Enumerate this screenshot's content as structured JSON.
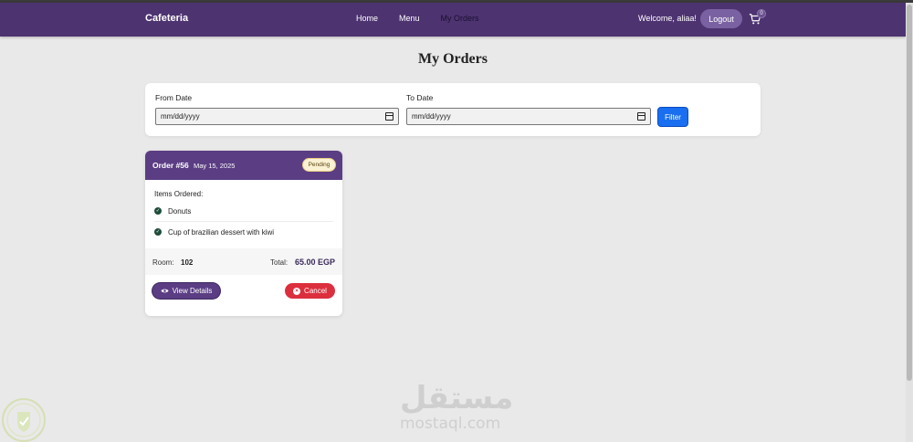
{
  "navbar": {
    "brand": "Cafeteria",
    "links": [
      "Home",
      "Menu",
      "My Orders"
    ],
    "active_link": "My Orders",
    "welcome": "Welcome, aliaa!",
    "logout_label": "Logout",
    "cart_count": "0",
    "bg_color": "#4e3371"
  },
  "page": {
    "title": "My Orders"
  },
  "filter": {
    "from_label": "From Date",
    "from_value": "mm/dd/yyyy",
    "to_label": "To Date",
    "to_value": "mm/dd/yyyy",
    "button_label": "Filter",
    "button_color": "#1a6ff0"
  },
  "order": {
    "number": "Order #56",
    "date": "May 15, 2025",
    "status": "Pending",
    "items_title": "Items Ordered:",
    "items": [
      "Donuts",
      "Cup of brazilian dessert with kiwi"
    ],
    "room_label": "Room:",
    "room_value": "102",
    "total_label": "Total:",
    "total_value": "65.00 EGP",
    "view_label": "View Details",
    "cancel_label": "Cancel",
    "header_color": "#5b3d84",
    "cancel_color": "#dc2f3e"
  },
  "watermark": {
    "arabic": "مستقل",
    "url": "mostaql.com"
  }
}
